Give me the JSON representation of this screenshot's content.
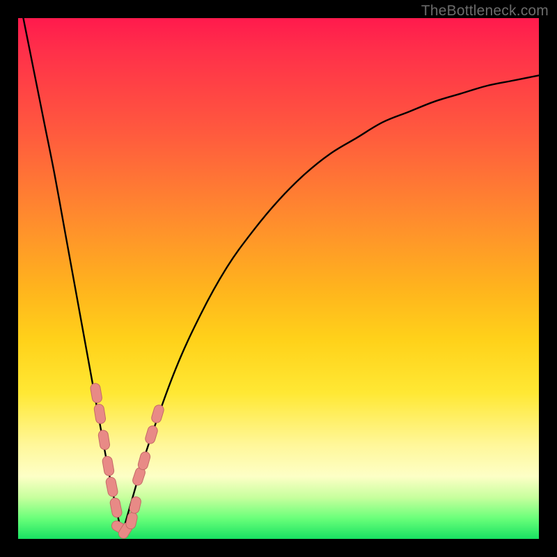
{
  "watermark": "TheBottleneck.com",
  "colors": {
    "frame": "#000000",
    "curve": "#000000",
    "bead_fill": "#e88a86",
    "bead_stroke": "#c46a66",
    "gradient_stops": [
      "#ff1a4d",
      "#ff5a3e",
      "#ffb41d",
      "#ffe834",
      "#fdffc6",
      "#18e262"
    ]
  },
  "chart_data": {
    "type": "line",
    "title": "",
    "xlabel": "",
    "ylabel": "",
    "xlim": [
      0,
      100
    ],
    "ylim": [
      0,
      100
    ],
    "grid": false,
    "note": "Two-branch V-shaped curve. y-axis encodes bottleneck percent (0 at bottom/green, 100 at top/red). Vertex near x≈20, y≈0.",
    "series": [
      {
        "name": "left-branch",
        "x": [
          1,
          3,
          5,
          7,
          9,
          11,
          13,
          15,
          17,
          19,
          20
        ],
        "y": [
          100,
          90,
          80,
          70,
          59,
          48,
          37,
          26,
          15,
          5,
          1
        ]
      },
      {
        "name": "right-branch",
        "x": [
          20,
          22,
          25,
          30,
          35,
          40,
          45,
          50,
          55,
          60,
          65,
          70,
          75,
          80,
          85,
          90,
          95,
          100
        ],
        "y": [
          1,
          8,
          18,
          32,
          43,
          52,
          59,
          65,
          70,
          74,
          77,
          80,
          82,
          84,
          85.5,
          87,
          88,
          89
        ]
      }
    ],
    "markers": {
      "name": "beads",
      "note": "Pink capsule-shaped markers clustered near the vertex on both branches.",
      "points_left": [
        {
          "x": 15.0,
          "y": 28
        },
        {
          "x": 15.7,
          "y": 24
        },
        {
          "x": 16.5,
          "y": 19
        },
        {
          "x": 17.3,
          "y": 14
        },
        {
          "x": 18.0,
          "y": 10
        },
        {
          "x": 18.8,
          "y": 6
        }
      ],
      "points_right": [
        {
          "x": 23.2,
          "y": 12
        },
        {
          "x": 24.2,
          "y": 15
        },
        {
          "x": 25.6,
          "y": 20
        },
        {
          "x": 26.8,
          "y": 24
        }
      ],
      "points_bottom": [
        {
          "x": 19.5,
          "y": 2.2
        },
        {
          "x": 20.6,
          "y": 1.6
        },
        {
          "x": 21.8,
          "y": 3.5
        },
        {
          "x": 22.5,
          "y": 6.5
        }
      ]
    }
  }
}
